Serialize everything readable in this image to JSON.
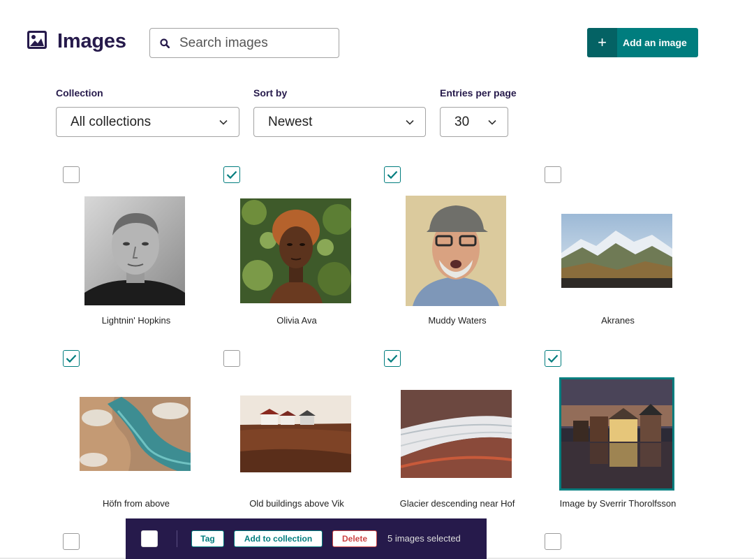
{
  "header": {
    "title": "Images",
    "search_placeholder": "Search images",
    "add_button_label": "Add an image"
  },
  "filters": {
    "collection": {
      "label": "Collection",
      "value": "All collections"
    },
    "sort": {
      "label": "Sort by",
      "value": "Newest"
    },
    "entries": {
      "label": "Entries per page",
      "value": "30"
    }
  },
  "colors": {
    "brand": "#261a4b",
    "accent": "#007d7e",
    "danger": "#cd4444"
  },
  "images": [
    {
      "title": "Lightnin' Hopkins",
      "checked": false
    },
    {
      "title": "Olivia Ava",
      "checked": true
    },
    {
      "title": "Muddy Waters",
      "checked": true
    },
    {
      "title": "Akranes",
      "checked": false
    },
    {
      "title": "Höfn from above",
      "checked": true
    },
    {
      "title": "Old buildings above Vik",
      "checked": false
    },
    {
      "title": "Glacier descending near Hof",
      "checked": true
    },
    {
      "title": "Image by Sverrir Thorolfsson",
      "checked": true
    }
  ],
  "bulk_actions": {
    "tag_label": "Tag",
    "add_to_collection_label": "Add to collection",
    "delete_label": "Delete",
    "selection_text": "5 images selected"
  }
}
